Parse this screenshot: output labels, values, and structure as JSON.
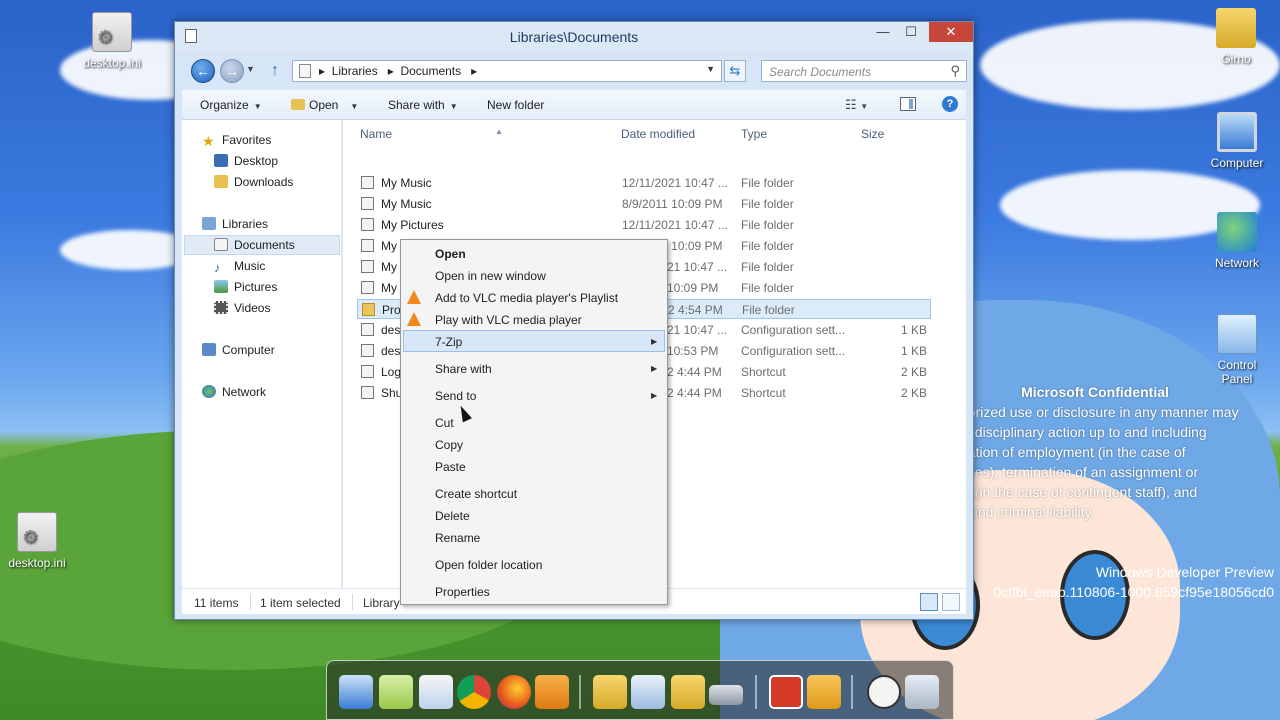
{
  "desktop": {
    "icons": [
      {
        "label": "desktop.ini"
      },
      {
        "label": "desktop.ini"
      },
      {
        "label": "Girno"
      },
      {
        "label": "Computer"
      },
      {
        "label": "Network"
      },
      {
        "label": "Control Panel"
      }
    ],
    "watermark": {
      "title": "Microsoft Confidential",
      "lines": [
        "horized use or disclosure in any manner may",
        "in disciplinary action up to and including",
        "nation of employment (in the case of",
        "yees), termination of an assignment or",
        "ct (in the case of contingent staff), and",
        "il and criminal liability."
      ],
      "build_name": "Windows Developer Preview",
      "build_id": "0ctfbl_eeap.110806-1000.859cf95e18056cd0"
    }
  },
  "window": {
    "title": "Libraries\\Documents",
    "controls": {
      "minimize": "—",
      "maximize": "☐",
      "close": "✕"
    },
    "address": {
      "path": [
        "Libraries",
        "Documents"
      ],
      "separator": "▸"
    },
    "search_placeholder": "Search Documents",
    "toolbar": {
      "organize": "Organize",
      "open": "Open",
      "share_with": "Share with",
      "new_folder": "New folder"
    },
    "nav": {
      "favorites": "Favorites",
      "desktop": "Desktop",
      "downloads": "Downloads",
      "libraries": "Libraries",
      "documents": "Documents",
      "music": "Music",
      "pictures": "Pictures",
      "videos": "Videos",
      "computer": "Computer",
      "network": "Network"
    },
    "columns": {
      "name": "Name",
      "date": "Date modified",
      "type": "Type",
      "size": "Size"
    },
    "files": [
      {
        "name": "My Music",
        "date": "12/11/2021 10:47 ...",
        "type": "File folder",
        "size": ""
      },
      {
        "name": "My Music",
        "date": "8/9/2011 10:09 PM",
        "type": "File folder",
        "size": ""
      },
      {
        "name": "My Pictures",
        "date": "12/11/2021 10:47 ...",
        "type": "File folder",
        "size": ""
      },
      {
        "name": "My Pictures",
        "date": "8/9/2011 10:09 PM",
        "type": "File folder",
        "size": ""
      },
      {
        "name": "My",
        "date": "21 10:47 ...",
        "type": "File folder",
        "size": ""
      },
      {
        "name": "My",
        "date": "10:09 PM",
        "type": "File folder",
        "size": ""
      },
      {
        "name": "Pro",
        "date": "2 4:54 PM",
        "type": "File folder",
        "size": ""
      },
      {
        "name": "des",
        "date": "21 10:47 ...",
        "type": "Configuration sett...",
        "size": "1 KB"
      },
      {
        "name": "des",
        "date": "10:53 PM",
        "type": "Configuration sett...",
        "size": "1 KB"
      },
      {
        "name": "Log",
        "date": "2 4:44 PM",
        "type": "Shortcut",
        "size": "2 KB"
      },
      {
        "name": "Shu",
        "date": "2 4:44 PM",
        "type": "Shortcut",
        "size": "2 KB"
      }
    ],
    "status": {
      "count": "11 items",
      "selected": "1 item selected",
      "location": "Library"
    }
  },
  "context_menu": {
    "items": [
      {
        "label": "Open"
      },
      {
        "label": "Open in new window"
      },
      {
        "label": "Add to VLC media player's Playlist"
      },
      {
        "label": "Play with VLC media player"
      },
      {
        "label": "7-Zip"
      },
      {
        "label": "Share with"
      },
      {
        "label": "Send to"
      },
      {
        "label": "Cut"
      },
      {
        "label": "Copy"
      },
      {
        "label": "Paste"
      },
      {
        "label": "Create shortcut"
      },
      {
        "label": "Delete"
      },
      {
        "label": "Rename"
      },
      {
        "label": "Open folder location"
      },
      {
        "label": "Properties"
      }
    ]
  },
  "colors": {
    "accent": "#2b78c7",
    "selection": "#dcebfa",
    "menu_highlight": "#d7e7f8",
    "close_button": "#c7463a"
  }
}
